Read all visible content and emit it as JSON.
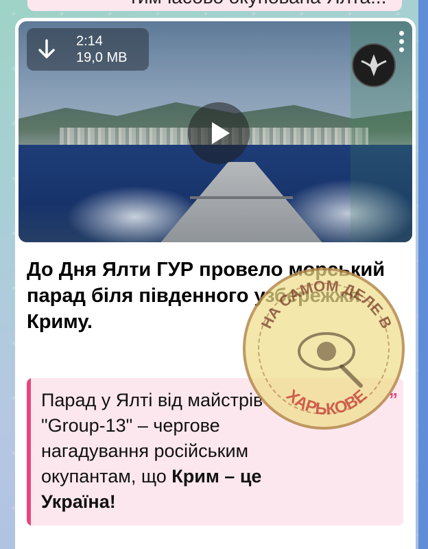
{
  "previous_message": {
    "text": "тимчасово окупована Ялта!.."
  },
  "video": {
    "duration": "2:14",
    "size": "19,0 MB",
    "icons": {
      "download": "download-arrow-icon",
      "more": "vertical-dots-icon",
      "play": "play-icon",
      "channel_logo": "channel-logo-icon"
    }
  },
  "post": {
    "title": "До Дня Ялти ГУР провело морський парад біля південного узбережжя Криму.",
    "quote_line1": "Парад у Ялті від майстрів",
    "quote_line2": "\"Group-13\" – чергове",
    "quote_line3": "нагадування російським",
    "quote_line4_prefix": "окупантам, що ",
    "quote_line4_bold": "Крим – це",
    "quote_line5_bold": "Україна!"
  },
  "watermark": {
    "top_text": "НА САМОМ ДЕЛЕ В",
    "bottom_text": "ХАРЬКОВЕ"
  },
  "colors": {
    "accent": "#e9457a",
    "quote_bg": "#fde7ee",
    "bubble_bg": "#ffffff"
  }
}
